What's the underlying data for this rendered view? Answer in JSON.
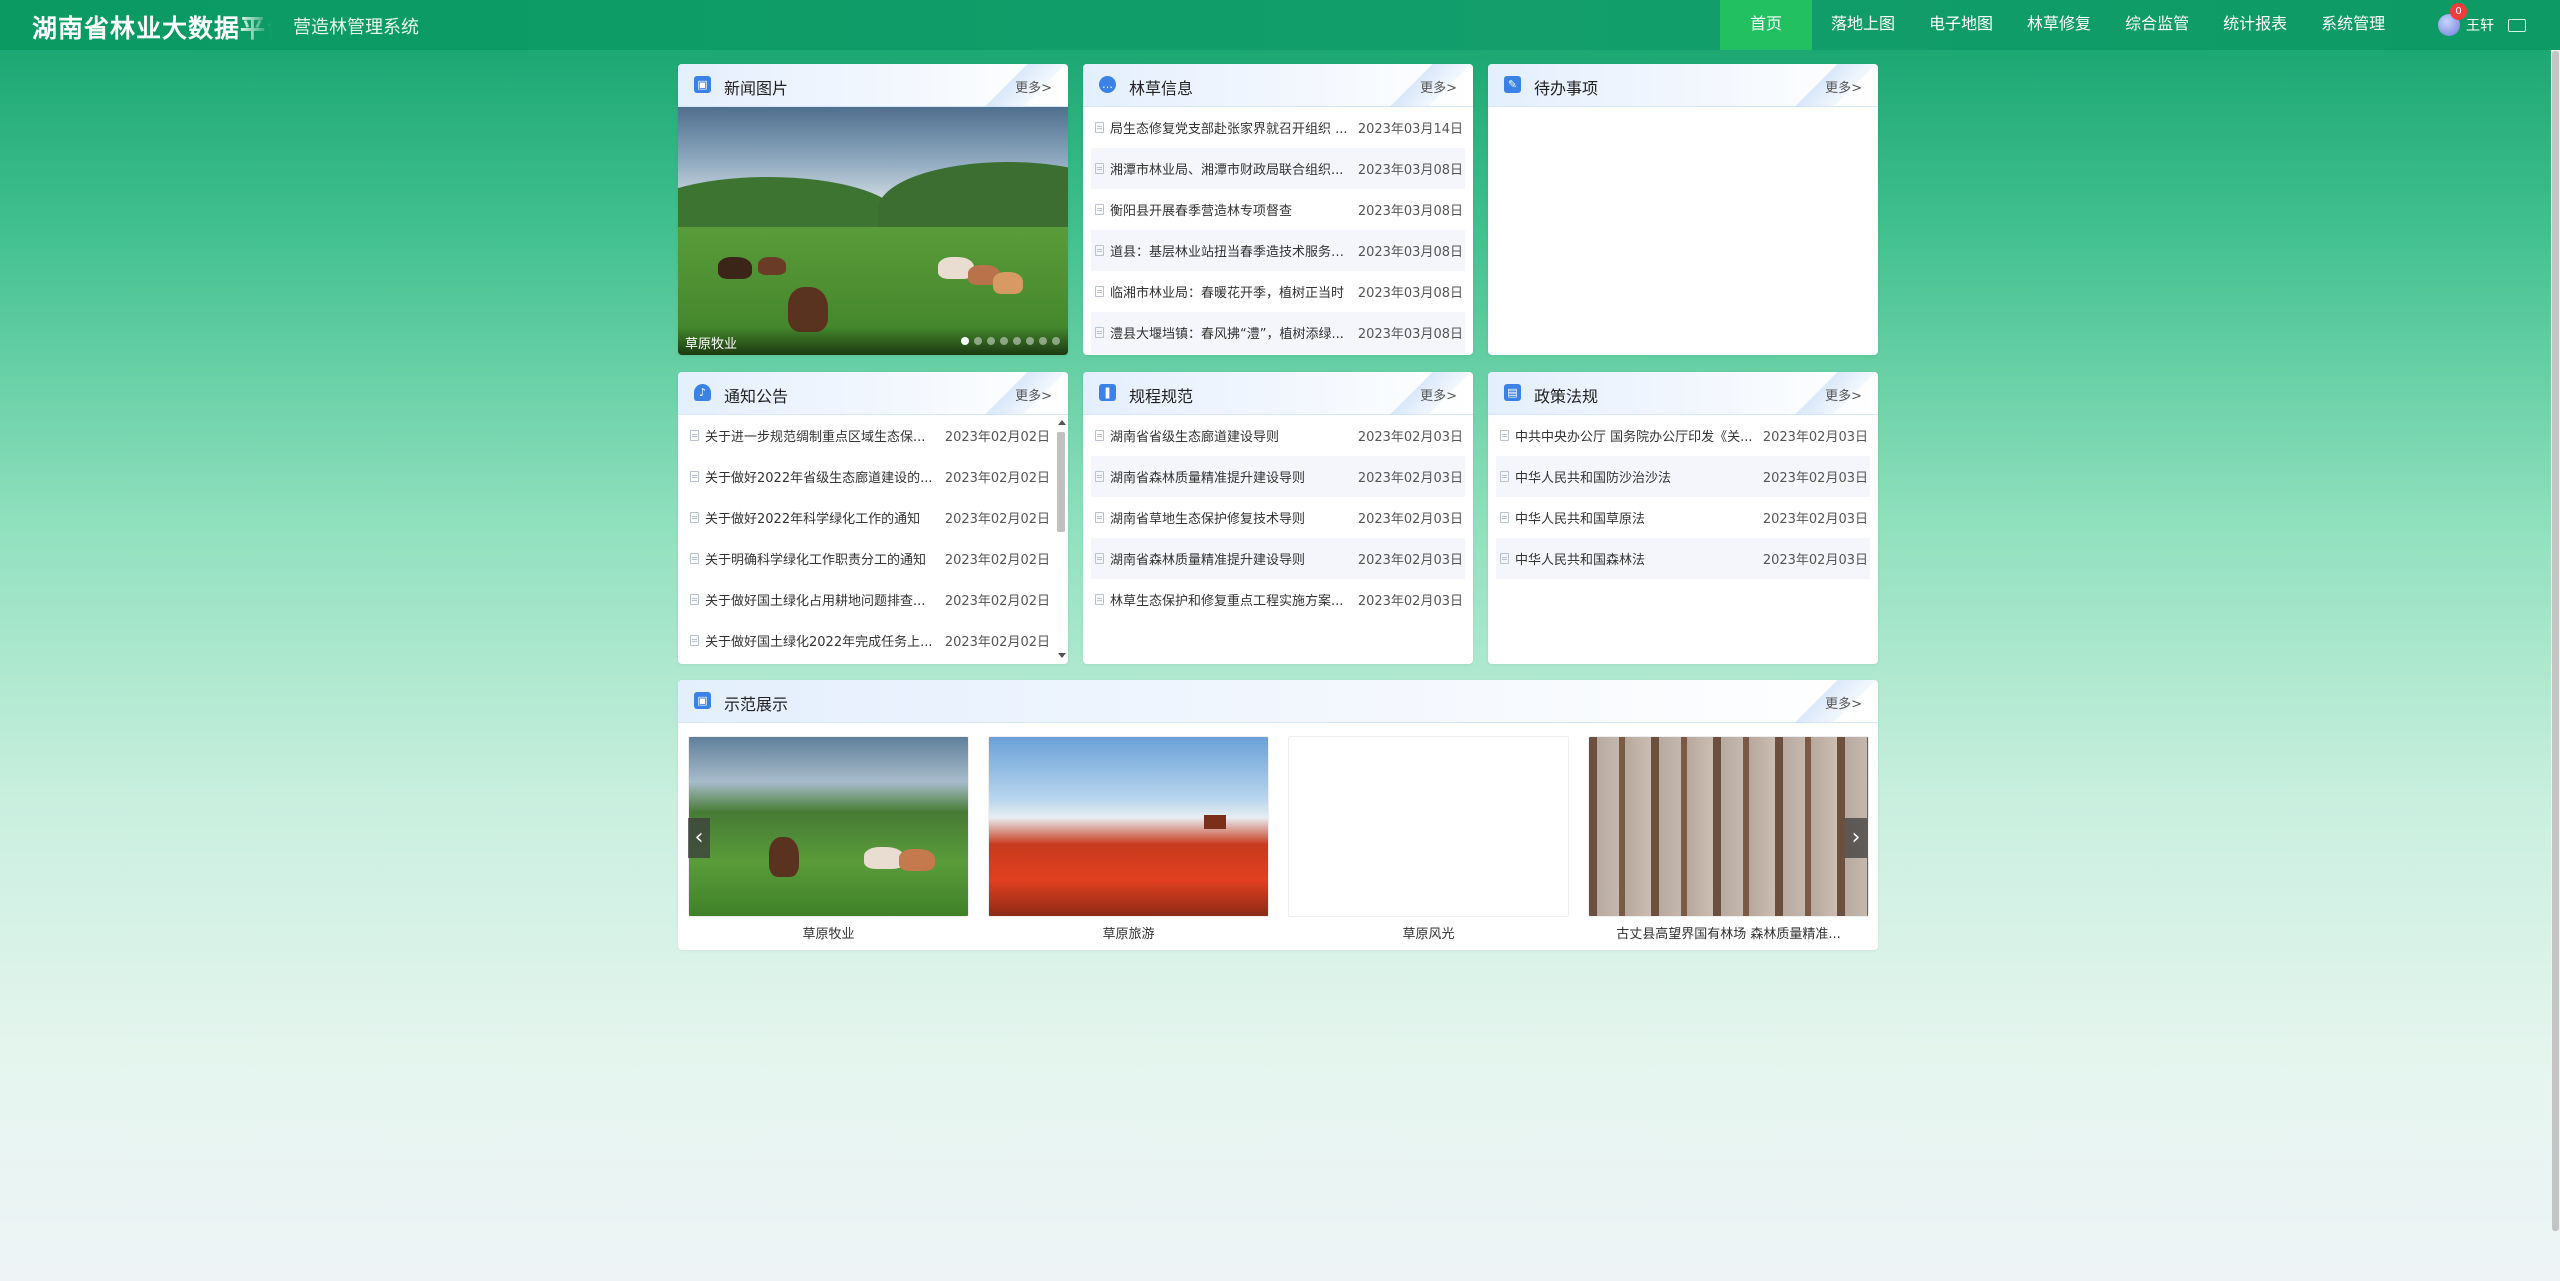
{
  "header": {
    "title": "湖南省林业大数据平台",
    "subtitle": "营造林管理系统",
    "nav": [
      "首页",
      "落地上图",
      "电子地图",
      "林草修复",
      "综合监管",
      "统计报表",
      "系统管理"
    ],
    "user_name": "王轩",
    "notice_count": "0"
  },
  "news_photo": {
    "title": "新闻图片",
    "more": "更多>",
    "caption": "草原牧业",
    "slide_count": 9,
    "active_slide": 1
  },
  "forestry_info": {
    "title": "林草信息",
    "more": "更多>",
    "items": [
      {
        "title": "局生态修复党支部赴张家界就召开组织 ...",
        "date": "2023年03月14日"
      },
      {
        "title": "湘潭市林业局、湘潭市财政局联合组织...",
        "date": "2023年03月08日"
      },
      {
        "title": "衡阳县开展春季营造林专项督查",
        "date": "2023年03月08日"
      },
      {
        "title": "道县：基层林业站扭当春季造技术服务主力",
        "date": "2023年03月08日"
      },
      {
        "title": "临湘市林业局：春暖花开季，植树正当时",
        "date": "2023年03月08日"
      },
      {
        "title": "澧县大堰垱镇：春风拂“澧”，植树添绿...",
        "date": "2023年03月08日"
      }
    ]
  },
  "todo": {
    "title": "待办事项",
    "more": "更多>"
  },
  "notices": {
    "title": "通知公告",
    "more": "更多>",
    "items": [
      {
        "title": "关于进一步规范绸制重点区域生态保...",
        "date": "2023年02月02日"
      },
      {
        "title": "关于做好2022年省级生态廊道建设的...",
        "date": "2023年02月02日"
      },
      {
        "title": "关于做好2022年科学绿化工作的通知",
        "date": "2023年02月02日"
      },
      {
        "title": "关于明确科学绿化工作职责分工的通知",
        "date": "2023年02月02日"
      },
      {
        "title": "关于做好国土绿化占用耕地问题排查...",
        "date": "2023年02月02日"
      },
      {
        "title": "关于做好国土绿化2022年完成任务上...",
        "date": "2023年02月02日"
      }
    ]
  },
  "regulations": {
    "title": "规程规范",
    "more": "更多>",
    "items": [
      {
        "title": "湖南省省级生态廊道建设导则",
        "date": "2023年02月03日"
      },
      {
        "title": "湖南省森林质量精准提升建设导则",
        "date": "2023年02月03日"
      },
      {
        "title": "湖南省草地生态保护修复技术导则",
        "date": "2023年02月03日"
      },
      {
        "title": "湖南省森林质量精准提升建设导则",
        "date": "2023年02月03日"
      },
      {
        "title": "林草生态保护和修复重点工程实施方案...",
        "date": "2023年02月03日"
      }
    ]
  },
  "policies": {
    "title": "政策法规",
    "more": "更多>",
    "items": [
      {
        "title": "中共中央办公厅 国务院办公厅印发《关...",
        "date": "2023年02月03日"
      },
      {
        "title": "中华人民共和国防沙治沙法",
        "date": "2023年02月03日"
      },
      {
        "title": "中华人民共和国草原法",
        "date": "2023年02月03日"
      },
      {
        "title": "中华人民共和国森林法",
        "date": "2023年02月03日"
      }
    ]
  },
  "demo": {
    "title": "示范展示",
    "more": "更多>",
    "items": [
      {
        "caption": "草原牧业"
      },
      {
        "caption": "草原旅游"
      },
      {
        "caption": "草原风光"
      },
      {
        "caption": "古丈县高望界国有林场 森林质量精准..."
      }
    ]
  },
  "icons": {
    "nav_avatar": "user-avatar-icon",
    "panel_news": "image-icon",
    "panel_info": "chat-icon",
    "panel_todo": "edit-icon",
    "panel_notice": "bell-icon",
    "panel_rules": "book-icon",
    "panel_policy": "id-card-icon",
    "panel_demo": "image-icon"
  },
  "colors": {
    "header": "#0a9a62",
    "nav_active": "#23c062",
    "panel_icon": "#3b82e6",
    "badge": "#f23b3b"
  }
}
